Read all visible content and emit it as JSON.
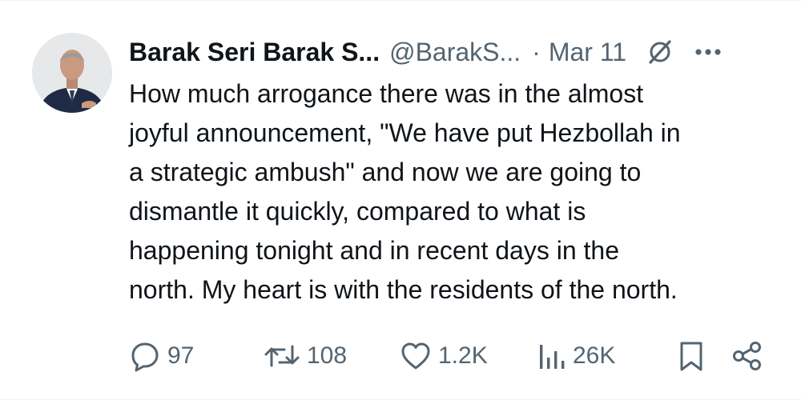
{
  "tweet": {
    "display_name": "Barak Seri Barak S...",
    "handle": "@BarakS...",
    "separator": "·",
    "date": "Mar 11",
    "text_lines": [
      "How much arrogance there was in the almost",
      "joyful announcement, \"We have put Hezbollah in",
      "a strategic ambush\" and now we are going to",
      "dismantle it quickly, compared to what is",
      "happening tonight and in recent days in the",
      "north. My heart is with the residents of the north."
    ]
  },
  "actions": {
    "replies": "97",
    "reposts": "108",
    "likes": "1.2K",
    "views": "26K"
  },
  "icons": {
    "grok": "grok-icon",
    "more": "more-icon",
    "reply": "reply-icon",
    "repost": "repost-icon",
    "like": "heart-icon",
    "views": "views-icon",
    "bookmark": "bookmark-icon",
    "share": "share-icon"
  },
  "colors": {
    "text_primary": "#0f1419",
    "text_secondary": "#536471",
    "background": "#ffffff"
  }
}
